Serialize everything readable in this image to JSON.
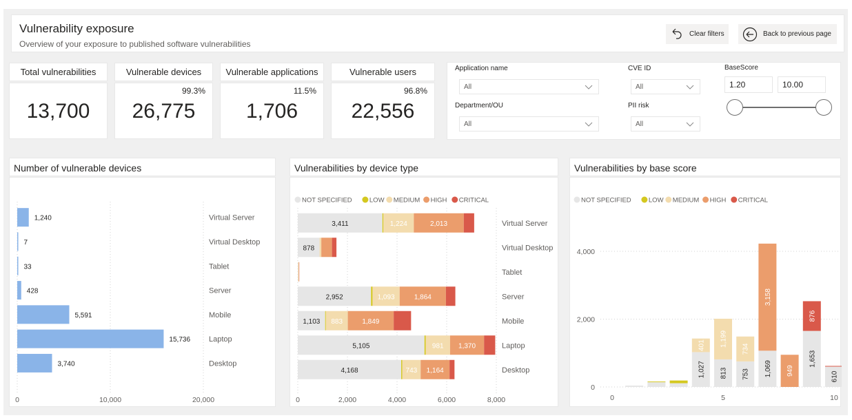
{
  "header": {
    "title": "Vulnerability exposure",
    "subtitle": "Overview of your exposure to published software vulnerabilities",
    "clear_filters_label": "Clear filters",
    "back_label": "Back to previous page"
  },
  "kpis": [
    {
      "label": "Total vulnerabilities",
      "value": "13,700",
      "pct": ""
    },
    {
      "label": "Vulnerable devices",
      "value": "26,775",
      "pct": "99.3%"
    },
    {
      "label": "Vulnerable applications",
      "value": "1,706",
      "pct": "11.5%"
    },
    {
      "label": "Vulnerable users",
      "value": "22,556",
      "pct": "96.8%"
    }
  ],
  "filters": {
    "application_name": {
      "label": "Application name",
      "value": "All"
    },
    "cve_id": {
      "label": "CVE ID",
      "value": "All"
    },
    "department": {
      "label": "Department/OU",
      "value": "All"
    },
    "pii_risk": {
      "label": "PII risk",
      "value": "All"
    },
    "basescore": {
      "label": "BaseScore",
      "min": "1.20",
      "max": "10.00"
    }
  },
  "colors": {
    "not_specified": "#e6e6e6",
    "low": "#d4c820",
    "medium": "#f3dcae",
    "high": "#eb9d6c",
    "critical": "#d9594a",
    "device_bar": "#8ab4e8"
  },
  "chart_data": [
    {
      "type": "bar",
      "orientation": "horizontal",
      "title": "Number of vulnerable devices",
      "categories": [
        "Virtual Server",
        "Virtual Desktop",
        "Tablet",
        "Server",
        "Mobile",
        "Laptop",
        "Desktop"
      ],
      "values": [
        1240,
        7,
        33,
        428,
        5591,
        15736,
        3740
      ],
      "value_labels": [
        "1,240",
        "7",
        "33",
        "428",
        "5,591",
        "15,736",
        "3,740"
      ],
      "xlim": [
        0,
        20000
      ],
      "xticks": [
        0,
        10000,
        20000
      ],
      "xtick_labels": [
        "0",
        "10,000",
        "20,000"
      ],
      "grid": true
    },
    {
      "type": "bar",
      "orientation": "horizontal",
      "stacked": true,
      "title": "Vulnerabilities by device type",
      "legend": [
        "NOT SPECIFIED",
        "LOW",
        "MEDIUM",
        "HIGH",
        "CRITICAL"
      ],
      "legend_position": "top-left",
      "categories": [
        "Virtual Server",
        "Virtual Desktop",
        "Tablet",
        "Server",
        "Mobile",
        "Laptop",
        "Desktop"
      ],
      "series": [
        {
          "name": "NOT SPECIFIED",
          "values": [
            3411,
            878,
            15,
            2952,
            1103,
            5105,
            4168
          ]
        },
        {
          "name": "LOW",
          "values": [
            40,
            0,
            0,
            60,
            30,
            50,
            40
          ]
        },
        {
          "name": "MEDIUM",
          "values": [
            1224,
            70,
            20,
            1093,
            883,
            981,
            743
          ]
        },
        {
          "name": "HIGH",
          "values": [
            2013,
            430,
            20,
            1864,
            1849,
            1370,
            1164
          ]
        },
        {
          "name": "CRITICAL",
          "values": [
            420,
            180,
            5,
            380,
            700,
            450,
            200
          ]
        }
      ],
      "data_labels": {
        "NOT SPECIFIED": [
          "3,411",
          "878",
          "",
          "2,952",
          "1,103",
          "5,105",
          "4,168"
        ],
        "MEDIUM": [
          "1,224",
          "",
          "",
          "1,093",
          "883",
          "981",
          "743"
        ],
        "HIGH": [
          "2,013",
          "",
          "",
          "1,864",
          "1,849",
          "1,370",
          "1,164"
        ]
      },
      "xlim": [
        0,
        8000
      ],
      "xticks": [
        0,
        2000,
        4000,
        6000,
        8000
      ],
      "xtick_labels": [
        "0",
        "2,000",
        "4,000",
        "6,000",
        "8,000"
      ],
      "grid": true
    },
    {
      "type": "bar",
      "orientation": "vertical",
      "stacked": true,
      "title": "Vulnerabilities by base score",
      "legend": [
        "NOT SPECIFIED",
        "LOW",
        "MEDIUM",
        "HIGH",
        "CRITICAL"
      ],
      "legend_position": "top-left",
      "x": [
        1,
        2,
        3,
        4,
        5,
        6,
        7,
        8,
        9,
        10
      ],
      "series": [
        {
          "name": "NOT SPECIFIED",
          "values": [
            40,
            140,
            110,
            1027,
            813,
            753,
            1069,
            0,
            1653,
            610
          ]
        },
        {
          "name": "LOW",
          "values": [
            0,
            20,
            80,
            0,
            0,
            0,
            0,
            0,
            0,
            0
          ]
        },
        {
          "name": "MEDIUM",
          "values": [
            0,
            0,
            0,
            401,
            1199,
            734,
            0,
            0,
            0,
            0
          ]
        },
        {
          "name": "HIGH",
          "values": [
            0,
            0,
            0,
            0,
            0,
            0,
            3158,
            949,
            0,
            0
          ]
        },
        {
          "name": "CRITICAL",
          "values": [
            0,
            0,
            0,
            0,
            0,
            0,
            0,
            0,
            876,
            10
          ]
        }
      ],
      "data_labels": {
        "NOT SPECIFIED": [
          "",
          "",
          "",
          "1,027",
          "813",
          "753",
          "1,069",
          "",
          "1,653",
          "610"
        ],
        "MEDIUM": [
          "",
          "",
          "",
          "401",
          "1,199",
          "734",
          "",
          "",
          "",
          ""
        ],
        "HIGH": [
          "",
          "",
          "",
          "",
          "",
          "",
          "3,158",
          "949",
          "",
          ""
        ],
        "CRITICAL": [
          "",
          "",
          "",
          "",
          "",
          "",
          "",
          "",
          "876",
          ""
        ]
      },
      "xlim": [
        0,
        10
      ],
      "xticks": [
        0,
        5,
        10
      ],
      "xtick_labels": [
        "0",
        "5",
        "10"
      ],
      "ylim": [
        0,
        4500
      ],
      "yticks": [
        0,
        2000,
        4000
      ],
      "ytick_labels": [
        "0",
        "2,000",
        "4,000"
      ],
      "grid": true
    }
  ]
}
